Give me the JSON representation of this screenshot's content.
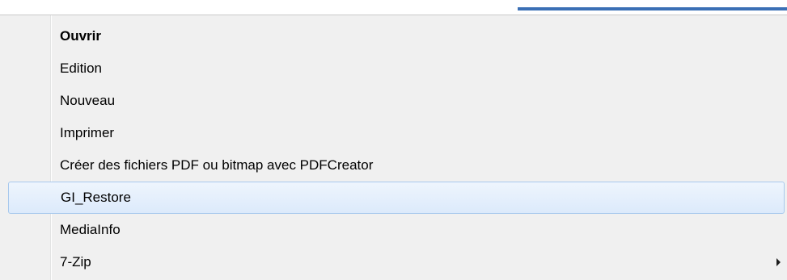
{
  "context_menu": {
    "items": [
      {
        "label": "Ouvrir",
        "bold": true,
        "highlighted": false,
        "has_submenu": false
      },
      {
        "label": "Edition",
        "bold": false,
        "highlighted": false,
        "has_submenu": false
      },
      {
        "label": "Nouveau",
        "bold": false,
        "highlighted": false,
        "has_submenu": false
      },
      {
        "label": "Imprimer",
        "bold": false,
        "highlighted": false,
        "has_submenu": false
      },
      {
        "label": "Créer des fichiers PDF ou bitmap avec PDFCreator",
        "bold": false,
        "highlighted": false,
        "has_submenu": false
      },
      {
        "label": "GI_Restore",
        "bold": false,
        "highlighted": true,
        "has_submenu": false
      },
      {
        "label": "MediaInfo",
        "bold": false,
        "highlighted": false,
        "has_submenu": false
      },
      {
        "label": "7-Zip",
        "bold": false,
        "highlighted": false,
        "has_submenu": true,
        "submenu_icon": "chevron-right-icon"
      }
    ]
  },
  "colors": {
    "menu_background": "#f0f0f0",
    "highlight_border": "#a8c9ed",
    "highlight_fill": "#dceafb",
    "behind_window_accent": "#3b6fb5"
  }
}
